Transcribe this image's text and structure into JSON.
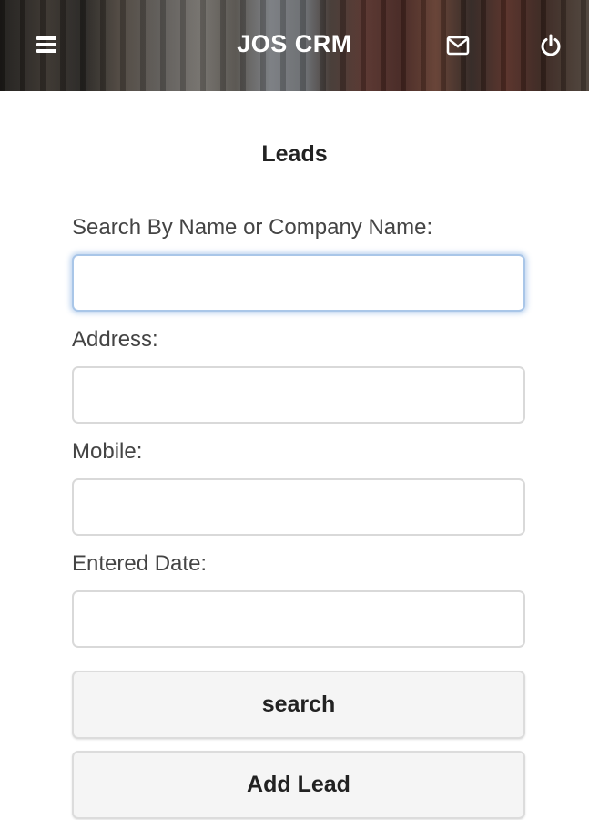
{
  "header": {
    "title": "JOS CRM",
    "icons": {
      "menu": "menu-icon",
      "mail": "mail-icon",
      "logout": "power-icon"
    }
  },
  "page": {
    "title": "Leads"
  },
  "form": {
    "search_label": "Search By Name or Company Name:",
    "search_value": "",
    "address_label": "Address:",
    "address_value": "",
    "mobile_label": "Mobile:",
    "mobile_value": "",
    "date_label": "Entered Date:",
    "date_value": ""
  },
  "buttons": {
    "search_label": "search",
    "add_label": "Add Lead"
  },
  "colors": {
    "focus_ring": "#a9c6e8",
    "button_bg": "#f5f5f5",
    "header_overlay": "#000000"
  }
}
